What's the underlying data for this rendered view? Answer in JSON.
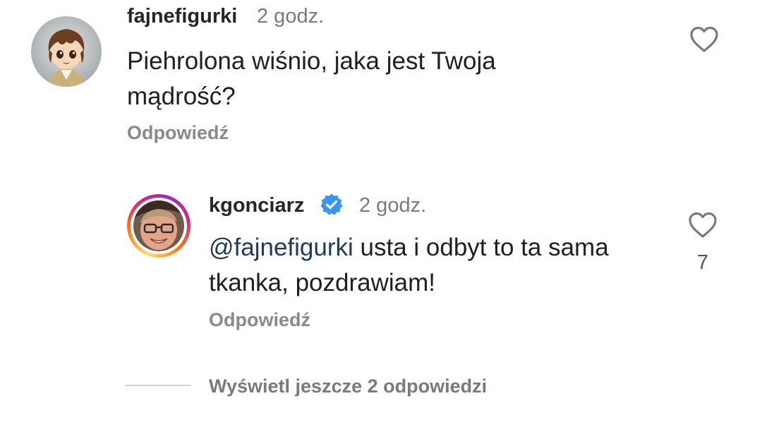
{
  "comments": [
    {
      "username": "fajnefigurki",
      "time": "2 godz.",
      "text": "Piehrolona wiśnio, jaka jest Twoja mądrość?",
      "text_line1": "Piehrolona wiśnio, jaka jest Twoja",
      "text_line2": "mądrość?",
      "reply_label": "Odpowiedź",
      "avatar_icon": "anime-boy-avatar"
    },
    {
      "username": "kgonciarz",
      "verified": true,
      "time": "2 godz.",
      "mention": "@fajnefigurki",
      "text_after_mention": " usta i odbyt to ta sama",
      "text_line2": "tkanka, pozdrawiam!",
      "reply_label": "Odpowiedź",
      "like_count": "7",
      "avatar_icon": "glasses-man-avatar"
    }
  ],
  "view_more_replies": "Wyświetl jeszcze 2 odpowiedzi",
  "colors": {
    "verified_blue": "#3897f0",
    "mention": "#1e3a5f",
    "secondary_text": "#8a8a8a",
    "story_ring_start": "#feda75",
    "story_ring_end": "#d62976"
  },
  "icons": {
    "like": "heart-outline-icon",
    "verified": "verified-badge-icon"
  }
}
